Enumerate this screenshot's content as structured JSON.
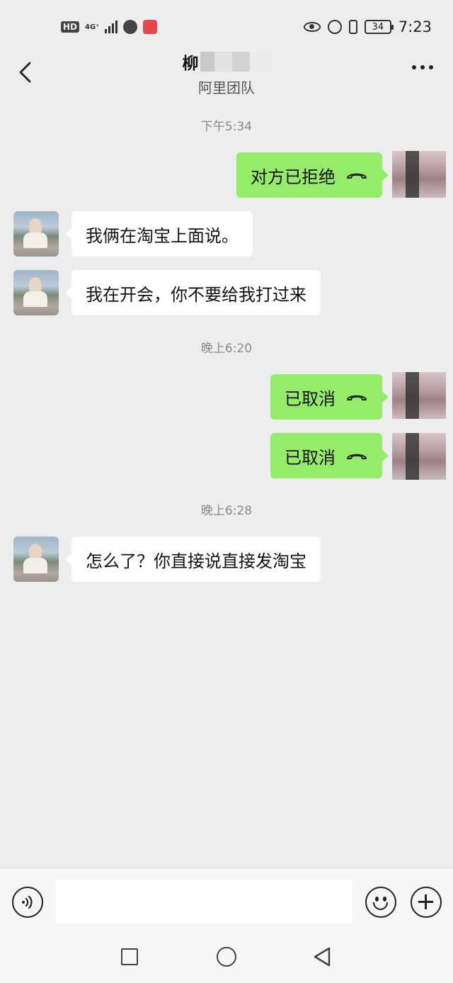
{
  "status_bar": {
    "hd": "HD",
    "network": "4G⁺",
    "battery": "34",
    "time": "7:23"
  },
  "header": {
    "name": "柳",
    "subtitle": "阿里团队"
  },
  "messages": [
    {
      "type": "timestamp",
      "text": "下午5:34"
    },
    {
      "type": "call",
      "side": "right",
      "text": "对方已拒绝"
    },
    {
      "type": "text",
      "side": "left",
      "text": "我俩在淘宝上面说。"
    },
    {
      "type": "text",
      "side": "left",
      "text": "我在开会，你不要给我打过来"
    },
    {
      "type": "timestamp",
      "text": "晚上6:20"
    },
    {
      "type": "call",
      "side": "right",
      "text": "已取消"
    },
    {
      "type": "call",
      "side": "right",
      "text": "已取消"
    },
    {
      "type": "timestamp",
      "text": "晚上6:28"
    },
    {
      "type": "text",
      "side": "left",
      "text": "怎么了？你直接说直接发淘宝"
    }
  ],
  "icons": {
    "back": "chevron-left-icon",
    "more": "more-dots-icon",
    "call": "phone-hangup-icon",
    "voice": "voice-icon",
    "emoji": "emoji-icon",
    "plus": "plus-icon"
  },
  "colors": {
    "background": "#ededed",
    "bubble_sent": "#95ec69",
    "bubble_received": "#ffffff",
    "timestamp_text": "#8a8a8a"
  }
}
